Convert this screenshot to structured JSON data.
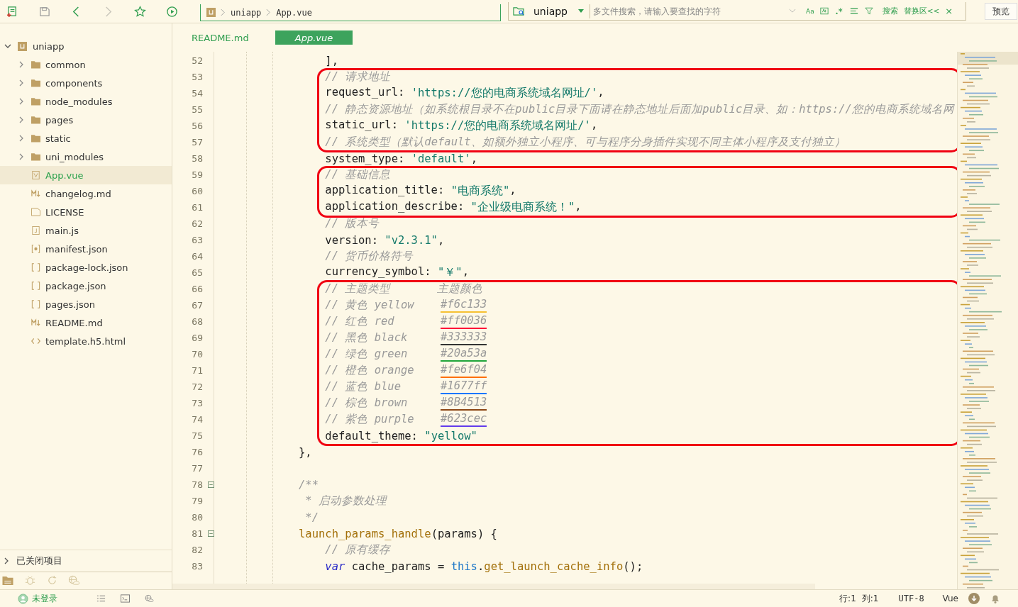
{
  "toolbar": {
    "breadcrumb": [
      "uniapp",
      "App.vue"
    ],
    "search": {
      "scope": "uniapp",
      "placeholder": "多文件搜索，请输入要查找的字符",
      "case_option": "Aa",
      "search_button": "搜索",
      "replace_toggle": "替换区<<",
      "close": "×"
    },
    "preview_button": "预览"
  },
  "sidebar": {
    "tree": [
      {
        "label": "uniapp",
        "expanded": true,
        "children": [
          {
            "label": "common",
            "kind": "folder",
            "expanded": false,
            "selected": false
          },
          {
            "label": "components",
            "kind": "folder",
            "expanded": false,
            "selected": false
          },
          {
            "label": "node_modules",
            "kind": "folder",
            "expanded": false,
            "selected": false
          },
          {
            "label": "pages",
            "kind": "folder",
            "expanded": false,
            "selected": false
          },
          {
            "label": "static",
            "kind": "folder",
            "expanded": false,
            "selected": false
          },
          {
            "label": "uni_modules",
            "kind": "folder",
            "expanded": false,
            "selected": false
          },
          {
            "label": "App.vue",
            "kind": "vue",
            "selected": true
          },
          {
            "label": "changelog.md",
            "kind": "markdown",
            "selected": false
          },
          {
            "label": "LICENSE",
            "kind": "plain",
            "selected": false
          },
          {
            "label": "main.js",
            "kind": "script",
            "selected": false
          },
          {
            "label": "manifest.json",
            "kind": "manifest",
            "selected": false
          },
          {
            "label": "package-lock.json",
            "kind": "json",
            "selected": false
          },
          {
            "label": "package.json",
            "kind": "json",
            "selected": false
          },
          {
            "label": "pages.json",
            "kind": "json",
            "selected": false
          },
          {
            "label": "README.md",
            "kind": "markdown",
            "selected": false
          },
          {
            "label": "template.h5.html",
            "kind": "html",
            "selected": false
          }
        ]
      }
    ],
    "closed_projects": {
      "label": "已关闭项目",
      "expanded": false
    }
  },
  "tabs": [
    {
      "label": "README.md",
      "selected": false
    },
    {
      "label": "App.vue",
      "selected": true
    }
  ],
  "code": {
    "groups": [
      {
        "kind": "plain",
        "lines": [
          {
            "number": "52",
            "fold": false,
            "tokens": [
              {
                "kind": "plain",
                "text": "                ],"
              }
            ]
          }
        ]
      },
      {
        "kind": "boxed",
        "lines": [
          {
            "number": "53",
            "fold": false,
            "tokens": [
              {
                "kind": "comment",
                "text": "                // 请求地址"
              }
            ]
          },
          {
            "number": "54",
            "fold": false,
            "tokens": [
              {
                "kind": "plain",
                "text": "                request_url: "
              },
              {
                "kind": "string",
                "text": "'https://您的电商系统域名网址/'"
              },
              {
                "kind": "plain",
                "text": ","
              }
            ]
          },
          {
            "number": "55",
            "fold": false,
            "tokens": [
              {
                "kind": "comment",
                "text": "                // 静态资源地址（如系统根目录不在public目录下面请在静态地址后面加public目录、如：https://您的电商系统域名网"
              }
            ]
          },
          {
            "number": "56",
            "fold": false,
            "tokens": [
              {
                "kind": "plain",
                "text": "                static_url: "
              },
              {
                "kind": "string",
                "text": "'https://您的电商系统域名网址/'"
              },
              {
                "kind": "plain",
                "text": ","
              }
            ]
          },
          {
            "number": "57",
            "fold": false,
            "tokens": [
              {
                "kind": "comment",
                "text": "                // 系统类型（默认default、如额外独立小程序、可与程序分身插件实现不同主体小程序及支付独立）"
              }
            ]
          }
        ]
      },
      {
        "kind": "plain",
        "lines": [
          {
            "number": "58",
            "fold": false,
            "tokens": [
              {
                "kind": "plain",
                "text": "                system_type: "
              },
              {
                "kind": "string",
                "text": "'default'"
              },
              {
                "kind": "plain",
                "text": ","
              }
            ]
          }
        ]
      },
      {
        "kind": "boxed",
        "lines": [
          {
            "number": "59",
            "fold": false,
            "tokens": [
              {
                "kind": "comment",
                "text": "                // 基础信息"
              }
            ]
          },
          {
            "number": "60",
            "fold": false,
            "tokens": [
              {
                "kind": "plain",
                "text": "                application_title: "
              },
              {
                "kind": "string",
                "text": "\"电商系统\""
              },
              {
                "kind": "plain",
                "text": ","
              }
            ]
          },
          {
            "number": "61",
            "fold": false,
            "tokens": [
              {
                "kind": "plain",
                "text": "                application_describe: "
              },
              {
                "kind": "string",
                "text": "\"企业级电商系统！\""
              },
              {
                "kind": "plain",
                "text": ","
              }
            ]
          }
        ]
      },
      {
        "kind": "plain",
        "lines": [
          {
            "number": "62",
            "fold": false,
            "tokens": [
              {
                "kind": "comment",
                "text": "                // 版本号"
              }
            ]
          },
          {
            "number": "63",
            "fold": false,
            "tokens": [
              {
                "kind": "plain",
                "text": "                version: "
              },
              {
                "kind": "string",
                "text": "\"v2.3.1\""
              },
              {
                "kind": "plain",
                "text": ","
              }
            ]
          },
          {
            "number": "64",
            "fold": false,
            "tokens": [
              {
                "kind": "comment",
                "text": "                // 货币价格符号"
              }
            ]
          },
          {
            "number": "65",
            "fold": false,
            "tokens": [
              {
                "kind": "plain",
                "text": "                currency_symbol: "
              },
              {
                "kind": "string",
                "text": "\"￥\""
              },
              {
                "kind": "plain",
                "text": ","
              }
            ]
          }
        ]
      },
      {
        "kind": "boxed",
        "lines": [
          {
            "number": "66",
            "fold": false,
            "tokens": [
              {
                "kind": "comment",
                "text": "                // 主题类型       主题颜色"
              }
            ]
          },
          {
            "number": "67",
            "fold": false,
            "tokens": [
              {
                "kind": "comment",
                "text": "                // 黄色 yellow    "
              },
              {
                "kind": "swatch",
                "text": "#f6c133",
                "color": "#f6c133"
              }
            ]
          },
          {
            "number": "68",
            "fold": false,
            "tokens": [
              {
                "kind": "comment",
                "text": "                // 红色 red       "
              },
              {
                "kind": "swatch",
                "text": "#ff0036",
                "color": "#ff0036"
              }
            ]
          },
          {
            "number": "69",
            "fold": false,
            "tokens": [
              {
                "kind": "comment",
                "text": "                // 黑色 black     "
              },
              {
                "kind": "swatch",
                "text": "#333333",
                "color": "#333333"
              }
            ]
          },
          {
            "number": "70",
            "fold": false,
            "tokens": [
              {
                "kind": "comment",
                "text": "                // 绿色 green     "
              },
              {
                "kind": "swatch",
                "text": "#20a53a",
                "color": "#20a53a"
              }
            ]
          },
          {
            "number": "71",
            "fold": false,
            "tokens": [
              {
                "kind": "comment",
                "text": "                // 橙色 orange    "
              },
              {
                "kind": "swatch",
                "text": "#fe6f04",
                "color": "#fe6f04"
              }
            ]
          },
          {
            "number": "72",
            "fold": false,
            "tokens": [
              {
                "kind": "comment",
                "text": "                // 蓝色 blue      "
              },
              {
                "kind": "swatch",
                "text": "#1677ff",
                "color": "#1677ff"
              }
            ]
          },
          {
            "number": "73",
            "fold": false,
            "tokens": [
              {
                "kind": "comment",
                "text": "                // 棕色 brown     "
              },
              {
                "kind": "swatch",
                "text": "#8B4513",
                "color": "#8b4513"
              }
            ]
          },
          {
            "number": "74",
            "fold": false,
            "tokens": [
              {
                "kind": "comment",
                "text": "                // 紫色 purple    "
              },
              {
                "kind": "swatch",
                "text": "#623cec",
                "color": "#623cec"
              }
            ]
          },
          {
            "number": "75",
            "fold": false,
            "tokens": [
              {
                "kind": "plain",
                "text": "                default_theme: "
              },
              {
                "kind": "string",
                "text": "\"yellow\""
              }
            ]
          }
        ]
      },
      {
        "kind": "plain",
        "lines": [
          {
            "number": "76",
            "fold": false,
            "tokens": [
              {
                "kind": "plain",
                "text": "            },"
              }
            ]
          },
          {
            "number": "77",
            "fold": false
          },
          {
            "number": "78",
            "fold": true,
            "tokens": [
              {
                "kind": "comment",
                "text": "            /**"
              }
            ]
          },
          {
            "number": "79",
            "fold": false,
            "tokens": [
              {
                "kind": "comment",
                "text": "             * 启动参数处理"
              }
            ]
          },
          {
            "number": "80",
            "fold": false,
            "tokens": [
              {
                "kind": "comment",
                "text": "             */"
              }
            ]
          },
          {
            "number": "81",
            "fold": true,
            "tokens": [
              {
                "kind": "function",
                "text": "            launch_params_handle"
              },
              {
                "kind": "plain",
                "text": "(params) {"
              }
            ]
          },
          {
            "number": "82",
            "fold": false,
            "tokens": [
              {
                "kind": "comment",
                "text": "                // 原有缓存"
              }
            ]
          },
          {
            "number": "83",
            "fold": false,
            "tokens": [
              {
                "kind": "keyword",
                "text": "                var"
              },
              {
                "kind": "plain",
                "text": " cache_params = "
              },
              {
                "kind": "builtin",
                "text": "this"
              },
              {
                "kind": "plain",
                "text": "."
              },
              {
                "kind": "function",
                "text": "get_launch_cache_info"
              },
              {
                "kind": "plain",
                "text": "();"
              }
            ]
          }
        ]
      }
    ]
  },
  "status_bar": {
    "login": "未登录",
    "position": [
      "行:1",
      "列:1"
    ],
    "encoding": "UTF-8",
    "language": "Vue"
  }
}
